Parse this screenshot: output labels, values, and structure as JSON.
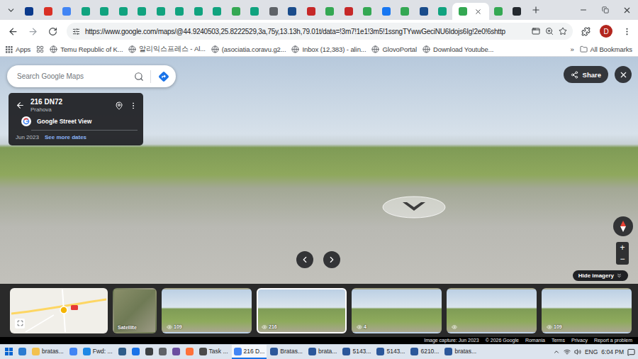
{
  "browser": {
    "tabs": [
      {
        "selected": false,
        "color": "#0b3a8c"
      },
      {
        "selected": false,
        "color": "#d93025"
      },
      {
        "selected": false,
        "color": "#4285f4"
      },
      {
        "selected": false,
        "color": "#10a37f"
      },
      {
        "selected": false,
        "color": "#10a37f"
      },
      {
        "selected": false,
        "color": "#10a37f"
      },
      {
        "selected": false,
        "color": "#10a37f"
      },
      {
        "selected": false,
        "color": "#10a37f"
      },
      {
        "selected": false,
        "color": "#10a37f"
      },
      {
        "selected": false,
        "color": "#10a37f"
      },
      {
        "selected": false,
        "color": "#10a37f"
      },
      {
        "selected": false,
        "color": "#34a853"
      },
      {
        "selected": false,
        "color": "#10a37f"
      },
      {
        "selected": false,
        "color": "#5f6368"
      },
      {
        "selected": false,
        "color": "#1a4c8b"
      },
      {
        "selected": false,
        "color": "#c62828"
      },
      {
        "selected": false,
        "color": "#34a853"
      },
      {
        "selected": false,
        "color": "#c62828"
      },
      {
        "selected": false,
        "color": "#34a853"
      },
      {
        "selected": false,
        "color": "#1877f2"
      },
      {
        "selected": false,
        "color": "#34a853"
      },
      {
        "selected": false,
        "color": "#1a4c8b"
      },
      {
        "selected": false,
        "color": "#10a37f"
      },
      {
        "selected": true,
        "color": "#34a853"
      },
      {
        "selected": false,
        "color": "#34a853"
      },
      {
        "selected": false,
        "color": "#24292f"
      }
    ]
  },
  "toolbar": {
    "nav": [
      {
        "kind": "back",
        "disabled": false
      },
      {
        "kind": "forward",
        "disabled": true
      },
      {
        "kind": "reload",
        "disabled": false
      }
    ],
    "url": "https://www.google.com/maps/@44.9240503,25.8222529,3a,75y,13.13h,79.01t/data=!3m7!1e1!3m5!1ssngTYwwGeciNU6Idojs6Ig!2e0!6shttp",
    "profile": "D"
  },
  "bookmarks": {
    "apps": "Apps",
    "items": [
      "Temu Republic of K...",
      "알리익스프레스 - Al...",
      "(asociatia.coravu.g2...",
      "Inbox (12,383) - alin...",
      "GlovoPortal",
      "Download Youtube..."
    ],
    "more": "»",
    "all": "All Bookmarks"
  },
  "maps": {
    "search_placeholder": "Search Google Maps",
    "place": {
      "title": "216 DN72",
      "region": "Prahova",
      "source": "Google Street View",
      "date": "Jun 2023",
      "more_dates": "See more dates"
    },
    "share": "Share",
    "zoom": [
      "+",
      "−"
    ],
    "hide_imagery": "Hide imagery",
    "thumbnails": [
      {
        "kind": "map",
        "label": "",
        "selected": false
      },
      {
        "kind": "satellite",
        "label": "Satellite",
        "selected": false
      },
      {
        "kind": "photo",
        "label": "109",
        "selected": false
      },
      {
        "kind": "photo",
        "label": "216",
        "selected": true
      },
      {
        "kind": "photo",
        "label": "4",
        "selected": false
      },
      {
        "kind": "photo",
        "label": "",
        "selected": false
      },
      {
        "kind": "photo",
        "label": "109",
        "selected": false
      }
    ],
    "footer": [
      "Image capture: Jun 2023",
      "© 2026 Google",
      "Romania",
      "Terms",
      "Privacy",
      "Report a problem"
    ]
  },
  "taskbar": {
    "items": [
      {
        "kind": "start",
        "label": "",
        "selected": false,
        "color": "#0a64d0"
      },
      {
        "kind": "app",
        "label": "",
        "selected": false,
        "color": "#2b7bd1"
      },
      {
        "kind": "window",
        "label": "bratas...",
        "selected": false,
        "color": "#f2c14e"
      },
      {
        "kind": "app",
        "label": "",
        "selected": false,
        "color": "#4285f4"
      },
      {
        "kind": "window",
        "label": "Fwd: ...",
        "selected": false,
        "color": "#1e88e5"
      },
      {
        "kind": "app",
        "label": "",
        "selected": false,
        "color": "#2f5d8a"
      },
      {
        "kind": "app",
        "label": "",
        "selected": false,
        "color": "#1a73e8"
      },
      {
        "kind": "app",
        "label": "",
        "selected": false,
        "color": "#3c4043"
      },
      {
        "kind": "app",
        "label": "",
        "selected": false,
        "color": "#5f6368"
      },
      {
        "kind": "app",
        "label": "",
        "selected": false,
        "color": "#6b4ea0"
      },
      {
        "kind": "app",
        "label": "",
        "selected": false,
        "color": "#ff7139"
      },
      {
        "kind": "window",
        "label": "Task ...",
        "selected": false,
        "color": "#4a4a4a"
      },
      {
        "kind": "window",
        "label": "216 D...",
        "selected": true,
        "color": "#4285f4"
      },
      {
        "kind": "window",
        "label": "Bratas...",
        "selected": false,
        "color": "#2b579a"
      },
      {
        "kind": "window",
        "label": "brata...",
        "selected": false,
        "color": "#2b579a"
      },
      {
        "kind": "window",
        "label": "5143...",
        "selected": false,
        "color": "#2b579a"
      },
      {
        "kind": "window",
        "label": "5143...",
        "selected": false,
        "color": "#2b579a"
      },
      {
        "kind": "window",
        "label": "6210...",
        "selected": false,
        "color": "#2b579a"
      },
      {
        "kind": "window",
        "label": "bratas...",
        "selected": false,
        "color": "#2b579a"
      }
    ],
    "language": "ENG",
    "time": "6:04 PM"
  }
}
